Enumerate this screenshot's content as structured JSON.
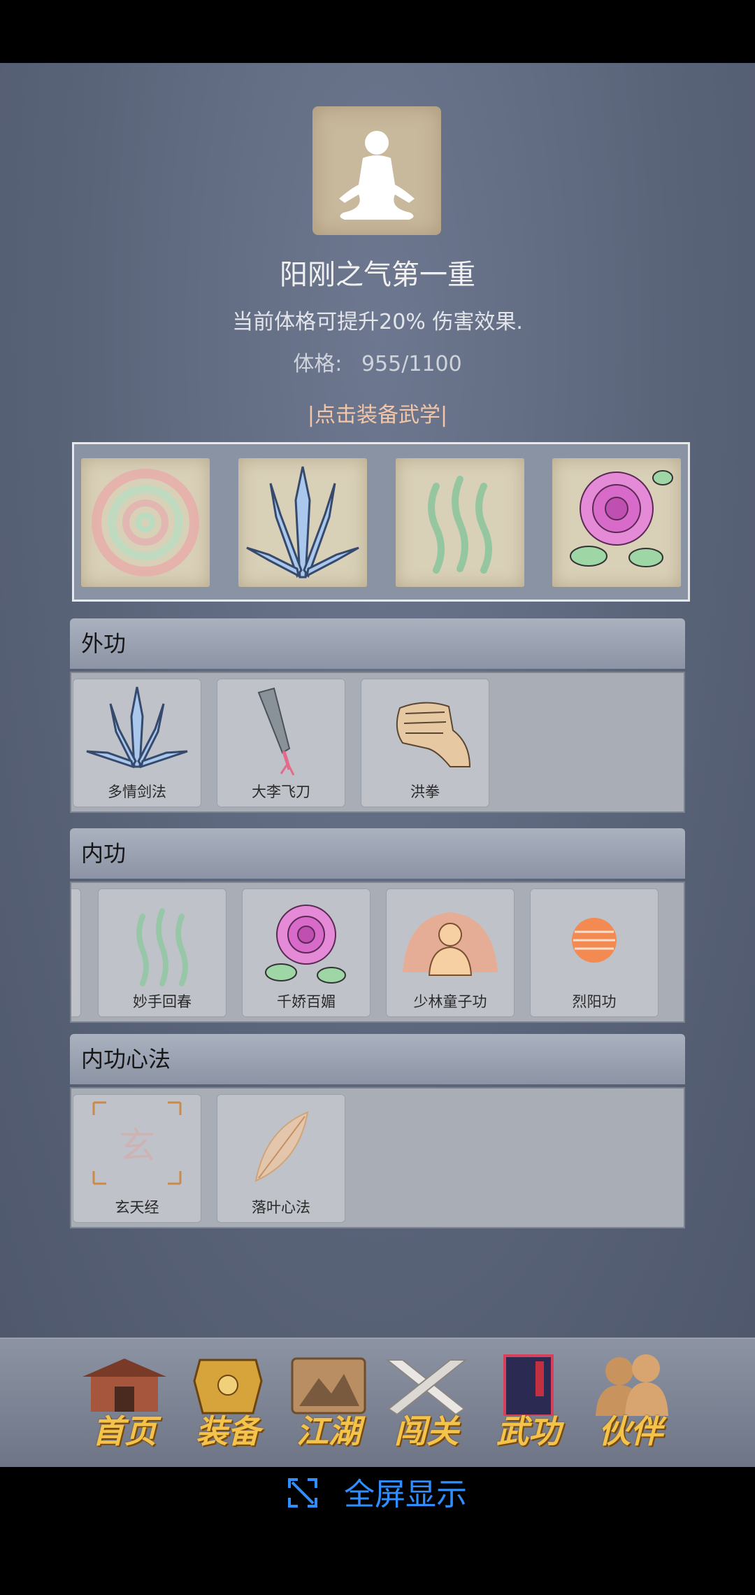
{
  "profile": {
    "title": "阳刚之气第一重",
    "description": "当前体格可提升20% 伤害效果.",
    "stat_label": "体格:",
    "stat_value": "955/1100",
    "portrait_icon": "meditating-figure-icon"
  },
  "equip_hint": "|点击装备武学|",
  "equipped_slots": [
    {
      "icon": "swirl-icon"
    },
    {
      "icon": "crystal-sword-icon"
    },
    {
      "icon": "green-waves-icon"
    },
    {
      "icon": "rose-icon"
    }
  ],
  "sections": [
    {
      "title": "外功",
      "skills": [
        {
          "name": "多情剑法",
          "icon": "crystal-sword-icon"
        },
        {
          "name": "大李飞刀",
          "icon": "flying-dagger-icon"
        },
        {
          "name": "洪拳",
          "icon": "fist-icon"
        }
      ]
    },
    {
      "title": "内功",
      "skills": [
        {
          "name": "妙手回春",
          "icon": "green-waves-icon"
        },
        {
          "name": "千娇百媚",
          "icon": "rose-icon"
        },
        {
          "name": "少林童子功",
          "icon": "buddha-icon"
        },
        {
          "name": "烈阳功",
          "icon": "sun-orb-icon"
        }
      ]
    },
    {
      "title": "内功心法",
      "skills": [
        {
          "name": "玄天经",
          "icon": "xuan-scroll-icon",
          "glyph": "玄"
        },
        {
          "name": "落叶心法",
          "icon": "leaf-icon"
        }
      ]
    }
  ],
  "nav": [
    {
      "label": "首页",
      "icon": "temple-icon"
    },
    {
      "label": "装备",
      "icon": "armor-icon"
    },
    {
      "label": "江湖",
      "icon": "scroll-map-icon"
    },
    {
      "label": "闯关",
      "icon": "crossed-swords-icon"
    },
    {
      "label": "武功",
      "icon": "book-icon"
    },
    {
      "label": "伙伴",
      "icon": "companions-icon"
    }
  ],
  "fullscreen_label": "全屏显示",
  "colors": {
    "accent_hint": "#f3c6a8",
    "nav_label": "#f3c34c",
    "fullscreen": "#2f8fff"
  }
}
